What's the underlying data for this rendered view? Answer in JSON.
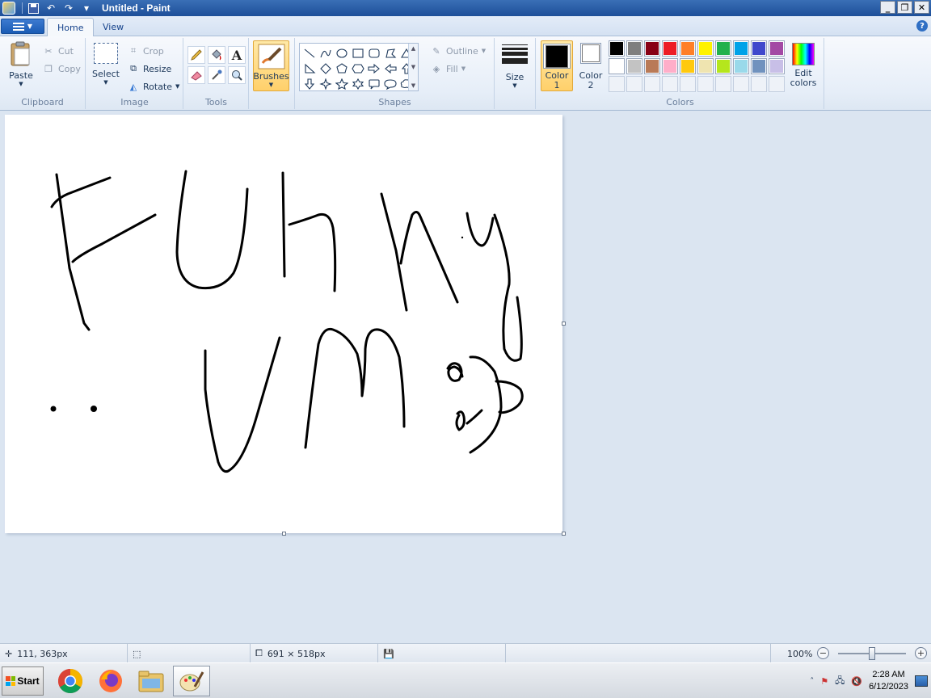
{
  "window": {
    "title": "Untitled - Paint"
  },
  "tabs": {
    "home": "Home",
    "view": "View"
  },
  "clipboard": {
    "paste": "Paste",
    "cut": "Cut",
    "copy": "Copy",
    "label": "Clipboard"
  },
  "image": {
    "select": "Select",
    "crop": "Crop",
    "resize": "Resize",
    "rotate": "Rotate",
    "label": "Image"
  },
  "tools": {
    "label": "Tools",
    "text_glyph": "A"
  },
  "brushes": {
    "label": "Brushes"
  },
  "shapes": {
    "outline": "Outline",
    "fill": "Fill",
    "label": "Shapes"
  },
  "size": {
    "label": "Size"
  },
  "colors": {
    "color1_line1": "Color",
    "color1_line2": "1",
    "color2_line1": "Color",
    "color2_line2": "2",
    "edit_line1": "Edit",
    "edit_line2": "colors",
    "label": "Colors",
    "color1": "#000000",
    "color2": "#ffffff",
    "palette_row1": [
      "#000000",
      "#7f7f7f",
      "#880015",
      "#ed1c24",
      "#ff7f27",
      "#fff200",
      "#22b14c",
      "#00a2e8",
      "#3f48cc",
      "#a349a4"
    ],
    "palette_row2": [
      "#ffffff",
      "#c3c3c3",
      "#b97a57",
      "#ffaec9",
      "#ffc90e",
      "#efe4b0",
      "#b5e61d",
      "#99d9ea",
      "#7092be",
      "#c8bfe7"
    ]
  },
  "status": {
    "cursor_pos": "111, 363px",
    "canvas_size": "691 × 518px",
    "zoom": "100%"
  },
  "taskbar": {
    "start": "Start",
    "time": "2:28 AM",
    "date": "6/12/2023"
  }
}
